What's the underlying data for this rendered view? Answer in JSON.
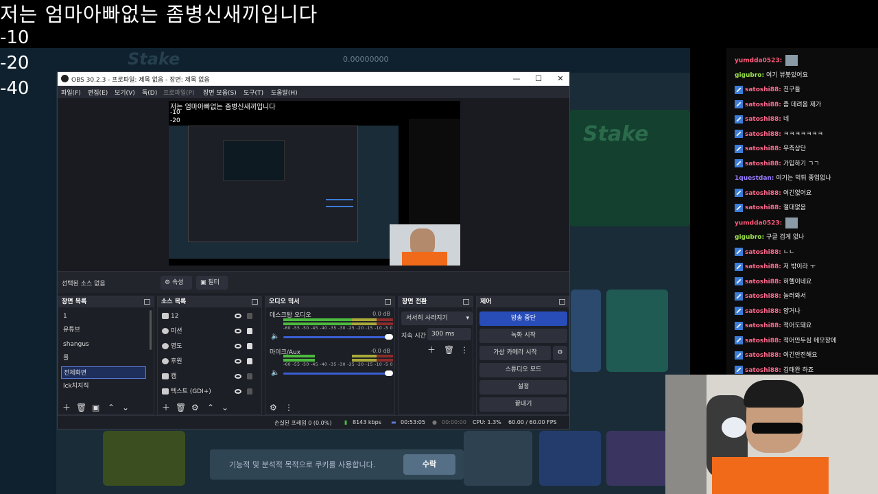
{
  "overlay": {
    "title": "저는 엄마아빠없는 좀병신새끼입니다",
    "numbers": [
      "-10",
      "-20",
      "-40"
    ]
  },
  "background_site": {
    "cookie_text": "기능적 및 분석적 목적으로 쿠키를 사용합니다.",
    "cookie_accept": "수락"
  },
  "obs": {
    "window_title": "OBS 30.2.3 - 프로파일: 제목 없음 - 장면: 제목 없음",
    "menu": [
      "파일(F)",
      "편집(E)",
      "보기(V)",
      "독(D)",
      "프로파일(P)",
      "장면 모음(S)",
      "도구(T)",
      "도움말(H)"
    ],
    "controls_bar": {
      "no_source": "선택된 소스 없음",
      "properties": "속성",
      "filters": "필터"
    },
    "scenes": {
      "header": "장면 목록",
      "items": [
        "1",
        "유튜브",
        "shangus",
        "룰",
        "전체화면",
        "lck치지직"
      ]
    },
    "sources": {
      "header": "소스 목록",
      "items": [
        "12",
        "미션",
        "영도",
        "후원",
        "캠",
        "텍스트 (GDI+)"
      ]
    },
    "mixer": {
      "header": "오디오 믹서",
      "channels": [
        {
          "name": "데스크탑 오디오",
          "db": "0.0 dB"
        },
        {
          "name": "마이크/Aux",
          "db": "-0.0 dB"
        }
      ],
      "scale": "-60 -55 -50 -45 -40 -35 -30 -25 -20 -15 -10 -5 0"
    },
    "transitions": {
      "header": "장면 전환",
      "selected": "서서히 사라지기",
      "duration_label": "지속 시간",
      "duration_value": "300 ms"
    },
    "controls": {
      "header": "제어",
      "stop_stream": "방송 중단",
      "start_recording": "녹화 시작",
      "start_virtual_cam": "가상 카메라 시작",
      "studio_mode": "스튜디오 모드",
      "settings": "설정",
      "exit": "끝내기"
    },
    "status": {
      "dropped_frames": "손실된 프레임 0 (0.0%)",
      "bitrate": "8143 kbps",
      "stream_time": "00:53:05",
      "record_time": "00:00:00",
      "cpu": "CPU: 1.3%",
      "fps": "60.00 / 60.00 FPS"
    }
  },
  "chat": {
    "messages": [
      {
        "user": "yumdda0523:",
        "text": "",
        "color": "#ff5a7d",
        "badge": false,
        "emote": true
      },
      {
        "user": "gigubro:",
        "text": "여기 뷰봇있어요",
        "color": "#9be04a",
        "badge": false,
        "emote": false
      },
      {
        "user": "satoshi88:",
        "text": "친구들",
        "color": "#ff6a8e",
        "badge": true,
        "emote": false
      },
      {
        "user": "satoshi88:",
        "text": "좀 데려옴 제가",
        "color": "#ff6a8e",
        "badge": true,
        "emote": false
      },
      {
        "user": "satoshi88:",
        "text": "네",
        "color": "#ff6a8e",
        "badge": true,
        "emote": false
      },
      {
        "user": "satoshi88:",
        "text": "ㅋㅋㅋㅋㅋㅋㅋ",
        "color": "#ff6a8e",
        "badge": true,
        "emote": false
      },
      {
        "user": "satoshi88:",
        "text": "우측상단",
        "color": "#ff6a8e",
        "badge": true,
        "emote": false
      },
      {
        "user": "satoshi88:",
        "text": "가입하기 ㄱㄱ",
        "color": "#ff6a8e",
        "badge": true,
        "emote": false
      },
      {
        "user": "1questdan:",
        "text": "여기는 먹튀 좋업없나",
        "color": "#9a7dff",
        "badge": false,
        "emote": false
      },
      {
        "user": "satoshi88:",
        "text": "여긴없어요",
        "color": "#ff6a8e",
        "badge": true,
        "emote": false
      },
      {
        "user": "satoshi88:",
        "text": "절대없음",
        "color": "#ff6a8e",
        "badge": true,
        "emote": false
      },
      {
        "user": "yumdda0523:",
        "text": "",
        "color": "#ff5a7d",
        "badge": false,
        "emote": true
      },
      {
        "user": "gigubro:",
        "text": "구글 검게 없나",
        "color": "#9be04a",
        "badge": false,
        "emote": false
      },
      {
        "user": "satoshi88:",
        "text": "ㄴㄴ",
        "color": "#ff6a8e",
        "badge": true,
        "emote": false
      },
      {
        "user": "satoshi88:",
        "text": "저 밖이라 ㅜ",
        "color": "#ff6a8e",
        "badge": true,
        "emote": false
      },
      {
        "user": "satoshi88:",
        "text": "허헬이네요",
        "color": "#ff6a8e",
        "badge": true,
        "emote": false
      },
      {
        "user": "satoshi88:",
        "text": "놀러와서",
        "color": "#ff6a8e",
        "badge": true,
        "emote": false
      },
      {
        "user": "satoshi88:",
        "text": "얌거나",
        "color": "#ff6a8e",
        "badge": true,
        "emote": false
      },
      {
        "user": "satoshi88:",
        "text": "적어도돼요",
        "color": "#ff6a8e",
        "badge": true,
        "emote": false
      },
      {
        "user": "satoshi88:",
        "text": "적어만두심 메모장에",
        "color": "#ff6a8e",
        "badge": true,
        "emote": false
      },
      {
        "user": "satoshi88:",
        "text": "여긴안전해요",
        "color": "#ff6a8e",
        "badge": true,
        "emote": false
      },
      {
        "user": "satoshi88:",
        "text": "김태완 하죠",
        "color": "#ff6a8e",
        "badge": true,
        "emote": false
      }
    ]
  }
}
